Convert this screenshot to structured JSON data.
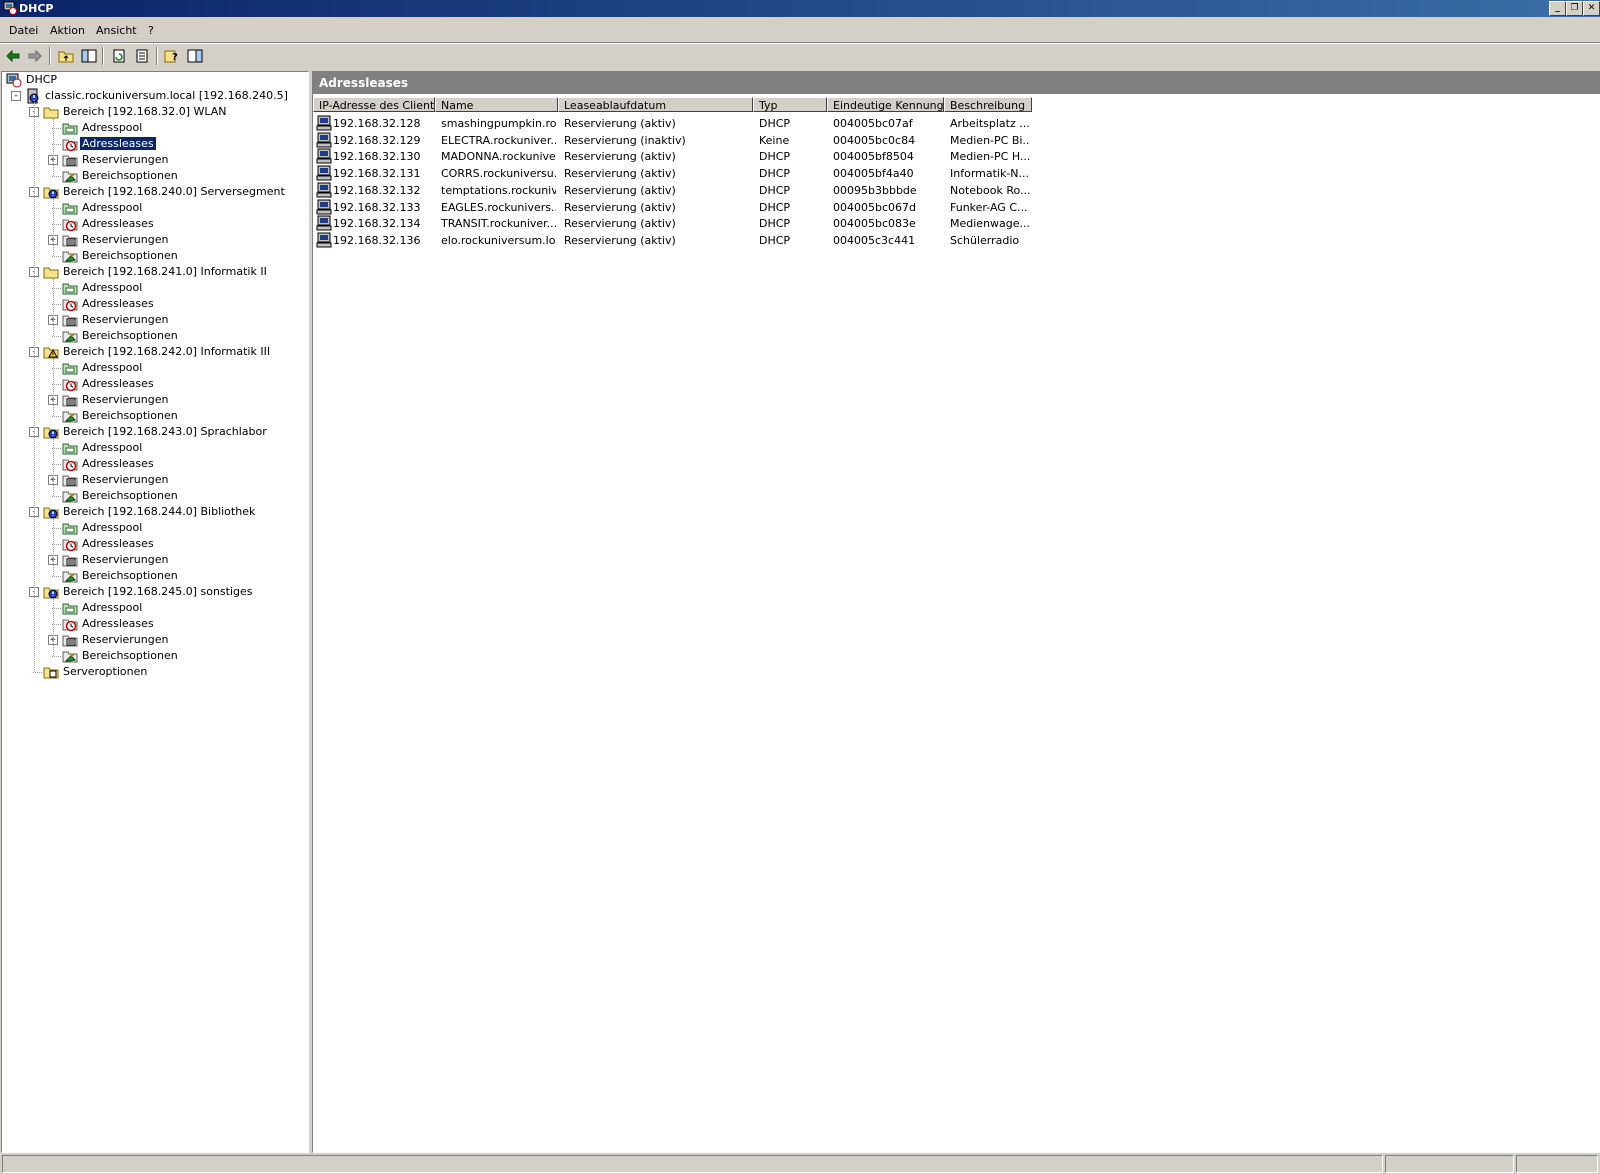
{
  "window": {
    "title": "DHCP"
  },
  "menu": [
    "Datei",
    "Aktion",
    "Ansicht",
    "?"
  ],
  "toolbar": [
    "back-icon",
    "forward-icon",
    "up-folder-icon",
    "show-tree-icon",
    "refresh-icon",
    "export-list-icon",
    "help-icon",
    "console-tree-icon"
  ],
  "tree": {
    "root": "DHCP",
    "server": "classic.rockuniversum.local [192.168.240.5]",
    "scopes": [
      {
        "label": "Bereich [192.168.32.0] WLAN",
        "icon": "folder-icon"
      },
      {
        "label": "Bereich [192.168.240.0] Serversegment",
        "icon": "scope-active-icon"
      },
      {
        "label": "Bereich [192.168.241.0] Informatik II",
        "icon": "folder-icon"
      },
      {
        "label": "Bereich [192.168.242.0] Informatik III",
        "icon": "scope-warning-icon"
      },
      {
        "label": "Bereich [192.168.243.0] Sprachlabor",
        "icon": "scope-active-icon"
      },
      {
        "label": "Bereich [192.168.244.0] Bibliothek",
        "icon": "scope-active-icon"
      },
      {
        "label": "Bereich [192.168.245.0] sonstiges",
        "icon": "scope-active-icon"
      }
    ],
    "children": [
      "Adresspool",
      "Adressleases",
      "Reservierungen",
      "Bereichsoptionen"
    ],
    "server_options": "Serveroptionen"
  },
  "detail": {
    "title": "Adressleases",
    "columns": [
      "IP-Adresse des Clients",
      "Name",
      "Leaseablaufdatum",
      "Typ",
      "Eindeutige Kennung",
      "Beschreibung"
    ],
    "rows": [
      [
        "192.168.32.128",
        "smashingpumpkin.ro...",
        "Reservierung (aktiv)",
        "DHCP",
        "004005bc07af",
        "Arbeitsplatz ..."
      ],
      [
        "192.168.32.129",
        "ELECTRA.rockuniver...",
        "Reservierung (inaktiv)",
        "Keine",
        "004005bc0c84",
        "Medien-PC Bi..."
      ],
      [
        "192.168.32.130",
        "MADONNA.rockunive...",
        "Reservierung (aktiv)",
        "DHCP",
        "004005bf8504",
        "Medien-PC H..."
      ],
      [
        "192.168.32.131",
        "CORRS.rockuniversu...",
        "Reservierung (aktiv)",
        "DHCP",
        "004005bf4a40",
        "Informatik-N..."
      ],
      [
        "192.168.32.132",
        "temptations.rockuniv...",
        "Reservierung (aktiv)",
        "DHCP",
        "00095b3bbbde",
        "Notebook Ro..."
      ],
      [
        "192.168.32.133",
        "EAGLES.rockunivers...",
        "Reservierung (aktiv)",
        "DHCP",
        "004005bc067d",
        "Funker-AG C..."
      ],
      [
        "192.168.32.134",
        "TRANSIT.rockuniver...",
        "Reservierung (aktiv)",
        "DHCP",
        "004005bc083e",
        "Medienwage..."
      ],
      [
        "192.168.32.136",
        "elo.rockuniversum.local",
        "Reservierung (aktiv)",
        "DHCP",
        "004005c3c441",
        "Schülerradio"
      ]
    ]
  },
  "colors": {
    "titlebar": "#0a246a",
    "selection": "#0a246a",
    "face": "#d4d0c8",
    "header": "#808080"
  }
}
